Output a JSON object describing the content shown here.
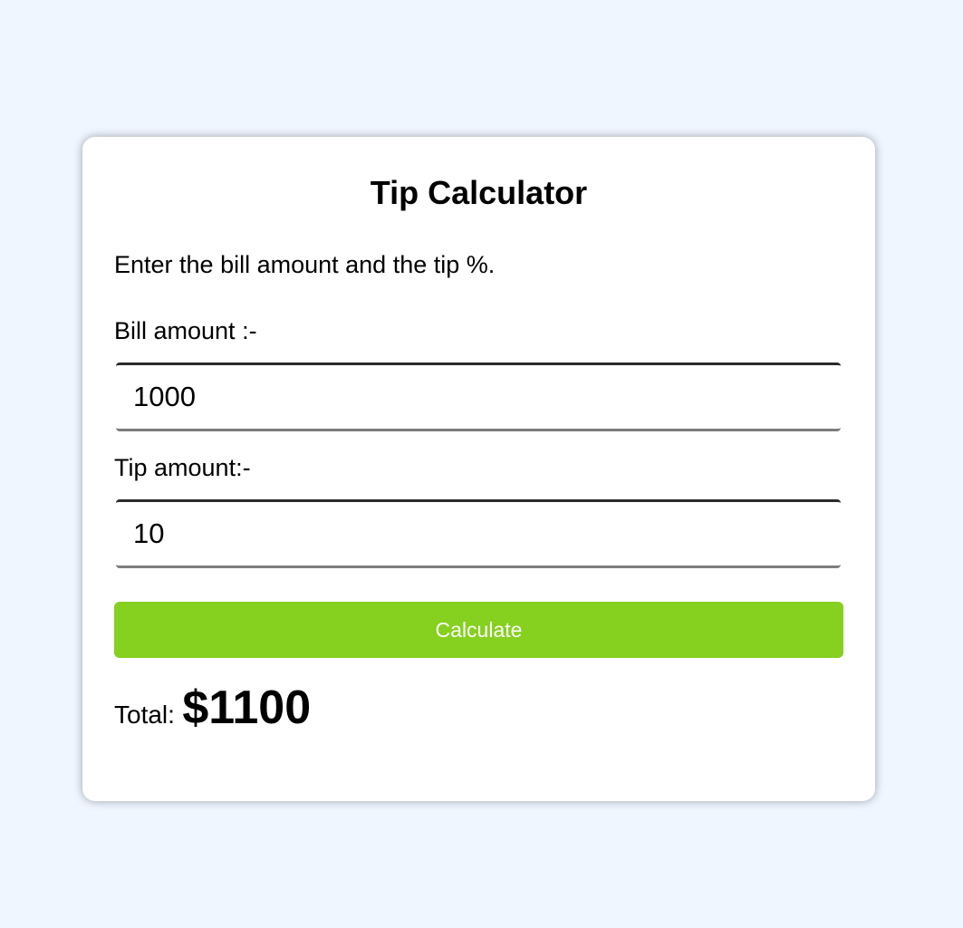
{
  "app": {
    "title": "Tip Calculator",
    "intro": "Enter the bill amount and the tip %."
  },
  "form": {
    "bill_label": "Bill amount :-",
    "bill_value": "1000",
    "tip_label": "Tip amount:-",
    "tip_value": "10",
    "calculate_label": "Calculate"
  },
  "result": {
    "total_label": "Total:",
    "total_value": "$1100"
  },
  "colors": {
    "background": "#eff6ff",
    "card": "#ffffff",
    "accent": "#86d01f"
  }
}
